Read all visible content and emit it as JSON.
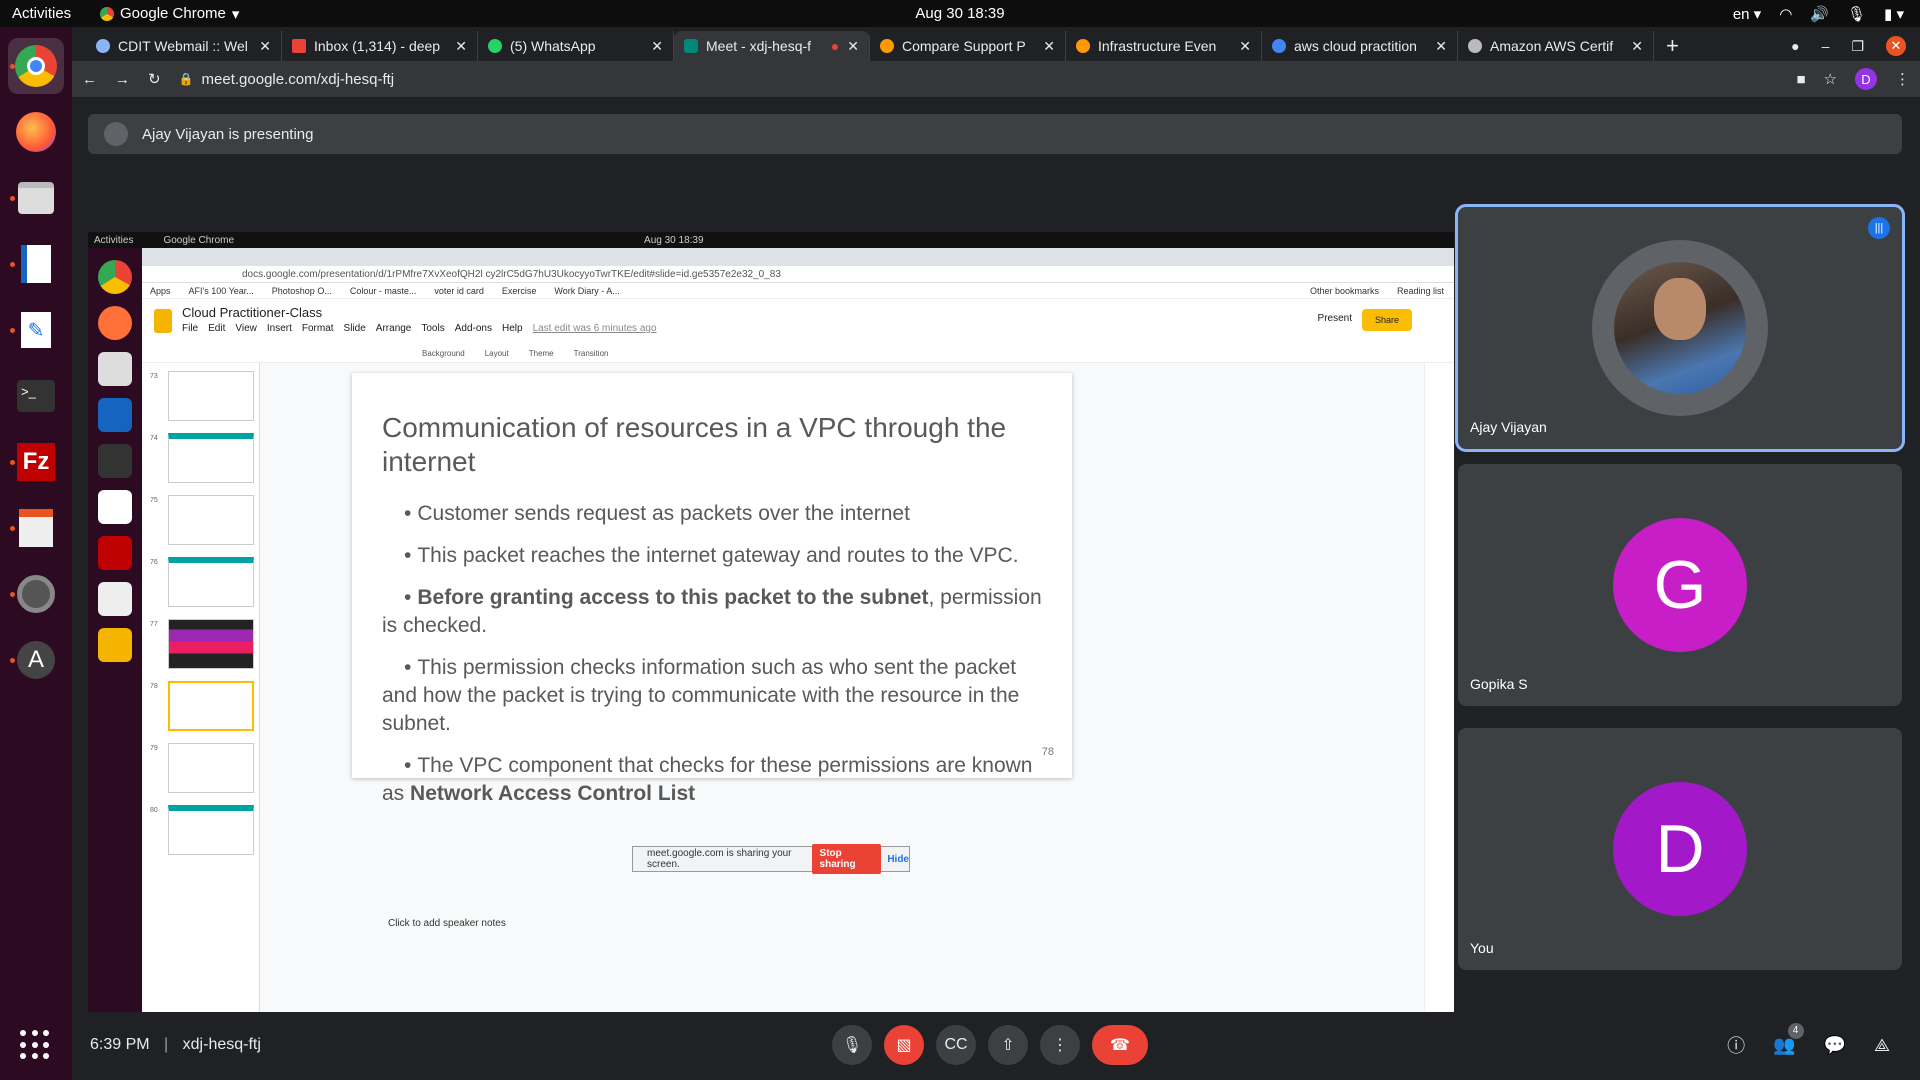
{
  "os": {
    "activities": "Activities",
    "app_name": "Google Chrome",
    "clock": "Aug 30  18:39",
    "lang": "en"
  },
  "tabs": [
    {
      "title": "CDIT Webmail :: Wel",
      "color": "#8ab4f8"
    },
    {
      "title": "Inbox (1,314) - deep",
      "color": "#ea4335"
    },
    {
      "title": "(5) WhatsApp",
      "color": "#25d366"
    },
    {
      "title": "Meet - xdj-hesq-f",
      "color": "#00897b",
      "active": true
    },
    {
      "title": "Compare Support P",
      "color": "#ff9900"
    },
    {
      "title": "Infrastructure Even",
      "color": "#ff9900"
    },
    {
      "title": "aws cloud practition",
      "color": "#4285f4"
    },
    {
      "title": "Amazon AWS Certif",
      "color": "#bbbbbb"
    }
  ],
  "address_bar": {
    "url": "meet.google.com/xdj-hesq-ftj",
    "profile_initial": "D"
  },
  "presenting": {
    "text": "Ajay Vijayan is presenting"
  },
  "shared": {
    "inner_activities": "Activities",
    "inner_app": "Google Chrome",
    "inner_clock": "Aug 30  18:39",
    "inner_url": "docs.google.com/presentation/d/1rPMfre7XvXeofQH2l cy2lrC5dG7hU3UkocyyoTwrTKE/edit#slide=id.ge5357e2e32_0_83",
    "bookmarks": [
      "Apps",
      "AFI's 100 Year...",
      "Photoshop O...",
      "Colour - maste...",
      "voter id card",
      "Exercise",
      "Work Diary - A...",
      "Other bookmarks",
      "Reading list"
    ],
    "doc_title": "Cloud Practitioner-Class",
    "menu": [
      "File",
      "Edit",
      "View",
      "Insert",
      "Format",
      "Slide",
      "Arrange",
      "Tools",
      "Add-ons",
      "Help",
      "Last edit was 6 minutes ago"
    ],
    "toolbar_items": [
      "Background",
      "Layout",
      "Theme",
      "Transition"
    ],
    "present_label": "Present",
    "share_label": "Share",
    "thumb_numbers": [
      "73",
      "74",
      "75",
      "76",
      "77",
      "78",
      "79",
      "80"
    ],
    "slide": {
      "title": "Communication of resources in a VPC through the internet",
      "bullet1": "Customer sends request as packets over the internet",
      "bullet2": "This packet reaches the internet gateway and routes to the VPC.",
      "bullet3_bold": "Before granting access to this packet to the subnet",
      "bullet3_rest": ", permission is checked.",
      "bullet4": "This permission checks information such as who sent the packet and how the packet is trying to communicate with the resource in the subnet.",
      "bullet5": "The VPC component that checks for these permissions are known as",
      "bullet5_bold": "Network Access Control List",
      "number": "78"
    },
    "speaker_notes": "Click to add speaker notes",
    "share_banner": {
      "text": "meet.google.com is sharing your screen.",
      "stop": "Stop sharing",
      "hide": "Hide"
    }
  },
  "participants": [
    {
      "name": "Ajay Vijayan",
      "type": "photo"
    },
    {
      "name": "Gopika S",
      "initial": "G",
      "color": "#c71ec7"
    },
    {
      "name": "You",
      "initial": "D",
      "color": "#a319c9"
    }
  ],
  "bottom": {
    "time": "6:39 PM",
    "separator": "|",
    "meeting_code": "xdj-hesq-ftj",
    "people_count": "4"
  }
}
